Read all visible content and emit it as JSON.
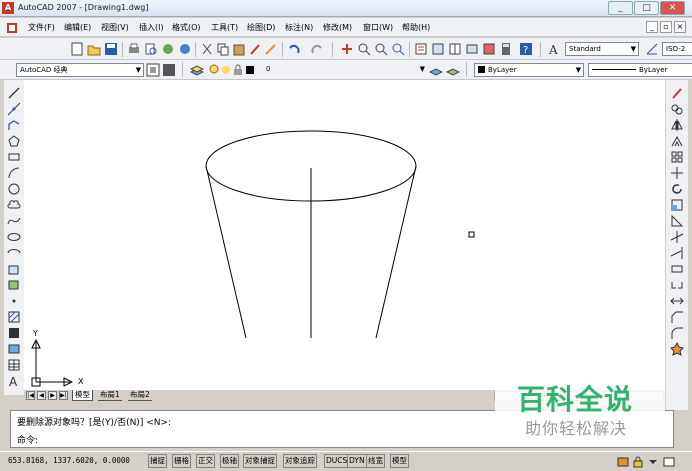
{
  "window": {
    "title": "AutoCAD 2007 - [Drawing1.dwg]",
    "app_icon_letter": "A",
    "minimize": "_",
    "maximize": "□",
    "close": "✕"
  },
  "menubar": {
    "items": [
      "文件(F)",
      "编辑(E)",
      "视图(V)",
      "插入(I)",
      "格式(O)",
      "工具(T)",
      "绘图(D)",
      "标注(N)",
      "修改(M)",
      "窗口(W)",
      "帮助(H)"
    ],
    "doc_min": "_",
    "doc_restore": "▫",
    "doc_close": "×"
  },
  "toolbar_standard": {
    "text_style": "Standard",
    "dim_style": "ISO-2"
  },
  "toolbar_properties": {
    "workspace": "AutoCAD 经典",
    "layer": "0",
    "color": "ByLayer",
    "linetype": "ByLayer"
  },
  "canvas": {
    "ucs_x_label": "X",
    "ucs_y_label": "Y"
  },
  "layout_tabs": {
    "items": [
      "模型",
      "布局1",
      "布局2"
    ],
    "active": "模型"
  },
  "command": {
    "line1": "要删除源对象吗？[是(Y)/否(N)] <N>:",
    "line2": "命令:"
  },
  "status": {
    "coordinates": "653.8168, 1337.6020, 0.0000",
    "toggles": [
      "捕捉",
      "栅格",
      "正交",
      "极轴",
      "对象捕捉",
      "对象追踪",
      "DUCS",
      "DYN",
      "线宽",
      "模型"
    ]
  },
  "watermark": {
    "title": "百科全说",
    "subtitle": "助你轻松解决"
  },
  "colors": {
    "accent_red": "#c0392b",
    "watermark_green": "#2fb36f"
  }
}
